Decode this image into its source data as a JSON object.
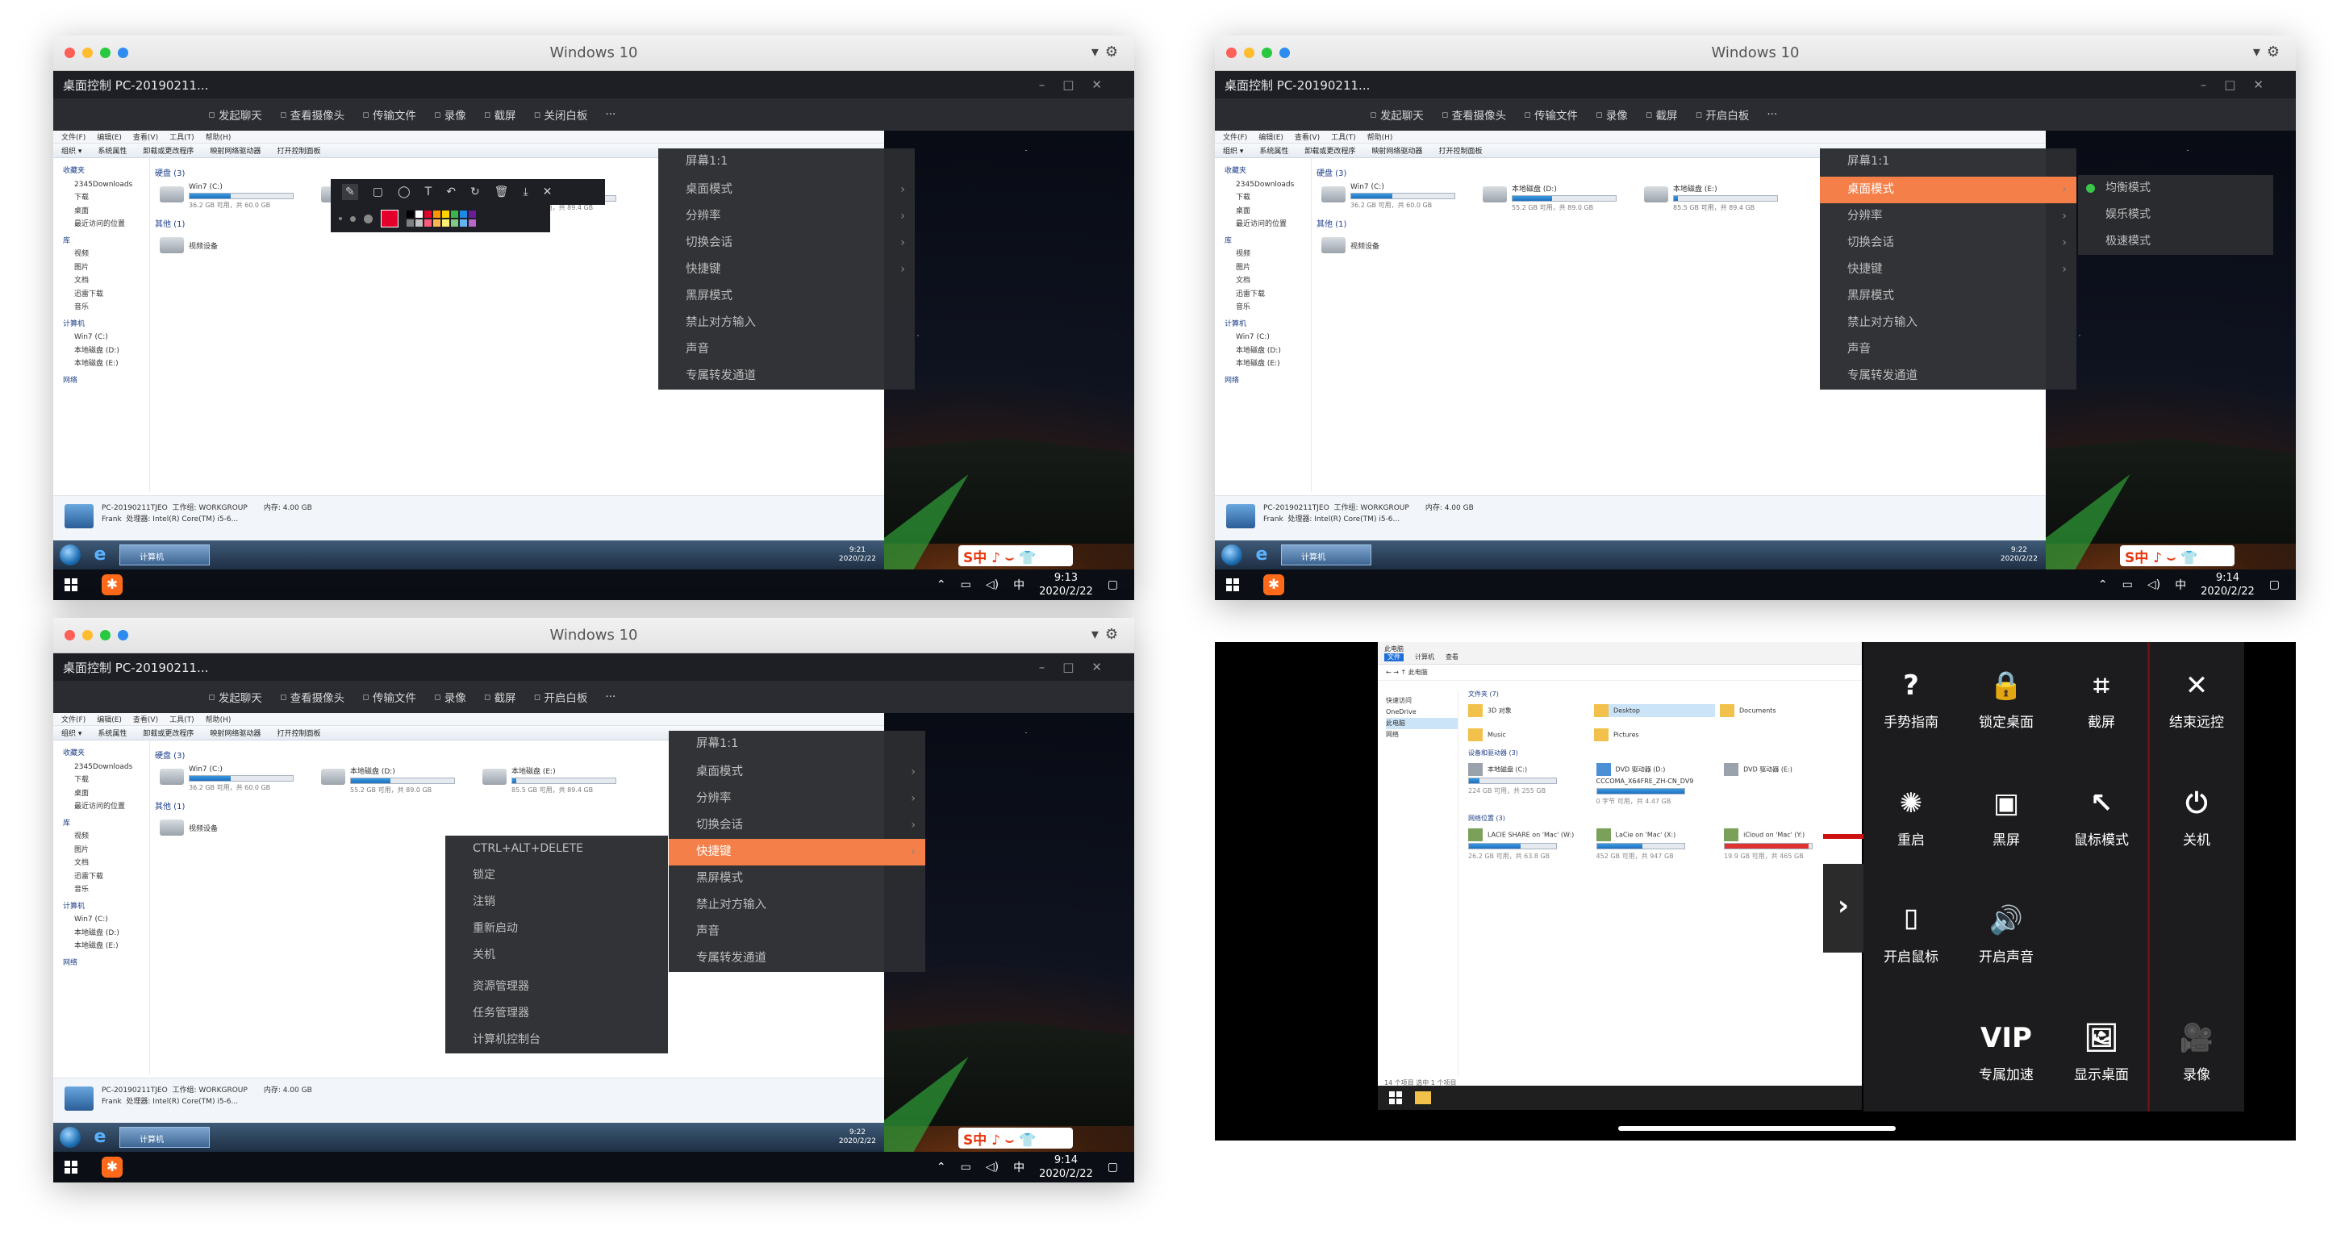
{
  "window_title": "Windows 10",
  "remote": {
    "title": "桌面控制 PC-20190211...",
    "toolbar": [
      "发起聊天",
      "查看摄像头",
      "传输文件",
      "录像",
      "截屏",
      "关闭白板",
      "开启白板"
    ],
    "menu_more": "···"
  },
  "explorer": {
    "menu": [
      "文件(F)",
      "编辑(E)",
      "查看(V)",
      "工具(T)",
      "帮助(H)"
    ],
    "commands": [
      "组织 ▾",
      "系统属性",
      "卸载或更改程序",
      "映射网络驱动器",
      "打开控制面板"
    ],
    "sidebar": [
      "收藏夹",
      "2345Downloads",
      "下载",
      "桌面",
      "最近访问的位置",
      "库",
      "视频",
      "图片",
      "文档",
      "迅雷下载",
      "音乐",
      "计算机",
      "Win7 (C:)",
      "本地磁盘 (D:)",
      "本地磁盘 (E:)",
      "网络"
    ],
    "group_disks": "硬盘 (3)",
    "group_other": "其他 (1)",
    "drives": [
      {
        "name": "Win7 (C:)",
        "free": "36.2 GB 可用，共 60.0 GB",
        "used_fraction": 0.4
      },
      {
        "name": "本地磁盘 (D:)",
        "free": "55.2 GB 可用，共 89.0 GB",
        "used_fraction": 0.38
      },
      {
        "name": "本地磁盘 (E:)",
        "free": "85.5 GB 可用，共 89.4 GB",
        "used_fraction": 0.04
      }
    ],
    "other_item": "视频设备",
    "status_name": "PC-20190211TJEO",
    "status_workgroup": "工作组: WORKGROUP",
    "status_mem": "内存: 4.00 GB",
    "status_user": "Frank",
    "status_cpu": "处理器: Intel(R) Core(TM) i5-6...",
    "taskbar_btn": "计算机",
    "sogou": "S中 ♪ ⌣ 👕"
  },
  "taskbar10": {
    "ime": "中"
  },
  "panels": [
    {
      "w7_time": "9:21",
      "w7_date": "2020/2/22",
      "time": "9:13",
      "date": "2020/2/22"
    },
    {
      "w7_time": "9:22",
      "w7_date": "2020/2/22",
      "time": "9:14",
      "date": "2020/2/22"
    },
    {
      "w7_time": "9:22",
      "w7_date": "2020/2/22",
      "time": "9:14",
      "date": "2020/2/22"
    }
  ],
  "main_menu": [
    "屏幕1:1",
    "桌面模式",
    "分辨率",
    "切换会话",
    "快捷键",
    "黑屏模式",
    "禁止对方输入",
    "声音",
    "专属转发通道"
  ],
  "desktop_submenu": [
    "均衡模式",
    "娱乐模式",
    "极速模式"
  ],
  "shortcut_submenu": [
    "CTRL+ALT+DELETE",
    "锁定",
    "注销",
    "重新启动",
    "关机",
    "资源管理器",
    "任务管理器",
    "计算机控制台"
  ],
  "draw_tools": [
    "✎",
    "▢",
    "◯",
    "T",
    "↶",
    "↻",
    "🗑",
    "⤓",
    "✕"
  ],
  "palette_colors": [
    "#000000",
    "#ffffff",
    "#e4002b",
    "#ff9500",
    "#ffd400",
    "#39b54a",
    "#1e88e5",
    "#6a1b9a",
    "#7f7f7f",
    "#c0c0c0",
    "#ff5a7a",
    "#ffb74d",
    "#fff176",
    "#81c784",
    "#64b5f6",
    "#ba68c8"
  ],
  "ipad": {
    "explorer_title": "此电脑",
    "ribbon": [
      "文件",
      "计算机",
      "查看"
    ],
    "path": "← → ↑ 此电脑",
    "sidebar": [
      "快速访问",
      "OneDrive",
      "此电脑",
      "网络"
    ],
    "folders_header": "文件夹 (7)",
    "folders": [
      "3D 对象",
      "Desktop",
      "Documents",
      "Music",
      "Pictures"
    ],
    "devices_header": "设备和驱动器 (3)",
    "devices": [
      "本地磁盘 (C:)",
      "DVD 驱动器 (D:) CCCOMA_X64FRE_ZH-CN_DV9",
      "DVD 驱动器 (E:)"
    ],
    "devices_sub": [
      "224 GB 可用，共 255 GB",
      "0 字节 可用，共 4.47 GB"
    ],
    "network_header": "网络位置 (3)",
    "network": [
      "LACIE SHARE on 'Mac' (W:)",
      "LaCie on 'Mac' (X:)",
      "iCloud on 'Mac' (Y:)"
    ],
    "network_sub": [
      "26.2 GB 可用，共 63.8 GB",
      "452 GB 可用，共 947 GB",
      "19.9 GB 可用，共 465 GB"
    ],
    "status": "14 个项目   选中 1 个项目",
    "side_arrow": "›",
    "grid": [
      {
        "icon": "?",
        "label": "手势指南",
        "name": "help-icon"
      },
      {
        "icon": "🔒",
        "label": "锁定桌面",
        "name": "lock-icon"
      },
      {
        "icon": "⌗",
        "label": "截屏",
        "name": "crop-icon"
      },
      {
        "icon": "✕",
        "label": "结束远控",
        "name": "close-icon"
      },
      {
        "icon": "✺",
        "label": "重启",
        "name": "restart-icon"
      },
      {
        "icon": "▣",
        "label": "黑屏",
        "name": "blackscreen-icon"
      },
      {
        "icon": "↖",
        "label": "鼠标模式",
        "name": "cursor-icon"
      },
      {
        "icon": "⏻",
        "label": "关机",
        "name": "power-icon"
      },
      {
        "icon": "⌷",
        "label": "开启鼠标",
        "name": "mouse-icon"
      },
      {
        "icon": "🔊",
        "label": "开启声音",
        "name": "speaker-icon"
      },
      {
        "icon": "VIP",
        "label": "专属加速",
        "name": "vip-icon"
      },
      {
        "icon": "🖼",
        "label": "显示桌面",
        "name": "desktop-icon"
      },
      {
        "icon": "🎥",
        "label": "录像",
        "name": "video-icon"
      }
    ]
  }
}
